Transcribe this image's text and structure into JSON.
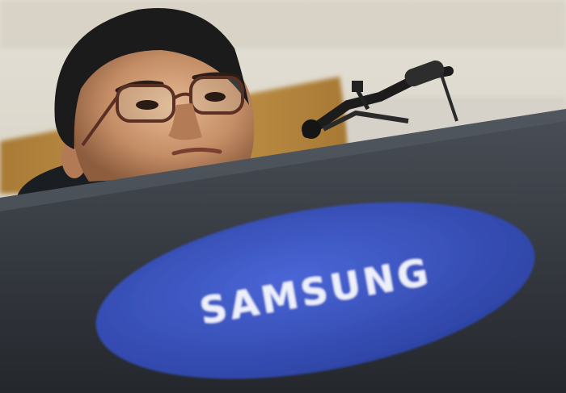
{
  "logo": {
    "text": "SAMSUNG",
    "color": "#2f4bbf",
    "text_color": "#ecf0fb"
  },
  "colors": {
    "wall": "#d9d4c7",
    "wood_panel": "#b88a3e",
    "podium": "#3a3f46",
    "suit": "#1a1d22",
    "skin": "#c9956f",
    "hair": "#1b1b1b"
  }
}
